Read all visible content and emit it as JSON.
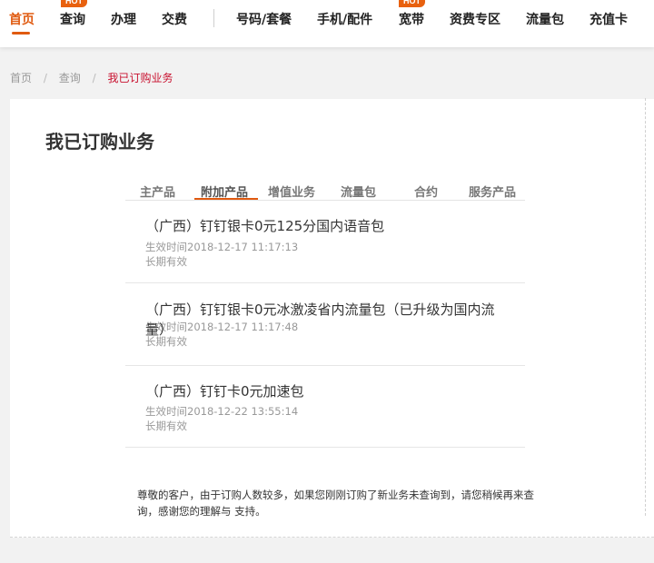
{
  "nav": {
    "items": [
      {
        "label": "首页"
      },
      {
        "label": "查询"
      },
      {
        "label": "办理"
      },
      {
        "label": "交费"
      },
      {
        "label": "号码/套餐"
      },
      {
        "label": "手机/配件"
      },
      {
        "label": "宽带"
      },
      {
        "label": "资费专区"
      },
      {
        "label": "流量包"
      },
      {
        "label": "充值卡"
      }
    ],
    "hot_badge": "HOT",
    "accent_color": "#e05a10"
  },
  "breadcrumb": {
    "home": "首页",
    "query": "查询",
    "current": "我已订购业务",
    "separator": "/"
  },
  "page": {
    "title": "我已订购业务"
  },
  "tabs": [
    {
      "label": "主产品"
    },
    {
      "label": "附加产品"
    },
    {
      "label": "增值业务"
    },
    {
      "label": "流量包"
    },
    {
      "label": "合约"
    },
    {
      "label": "服务产品"
    }
  ],
  "products": [
    {
      "name": "（广西）钉钉银卡0元125分国内语音包",
      "effective": "生效时间2018-12-17 11:17:13",
      "validity": "长期有效"
    },
    {
      "name": "（广西）钉钉银卡0元冰激凌省内流量包（已升级为国内流量）",
      "effective": "生效时间2018-12-17 11:17:48",
      "validity": "长期有效"
    },
    {
      "name": "（广西）钉钉卡0元加速包",
      "effective": "生效时间2018-12-22 13:55:14",
      "validity": "长期有效"
    }
  ],
  "notice": "尊敬的客户，由于订购人数较多，如果您刚刚订购了新业务未查询到，请您稍候再来查询，感谢您的理解与 支持。"
}
